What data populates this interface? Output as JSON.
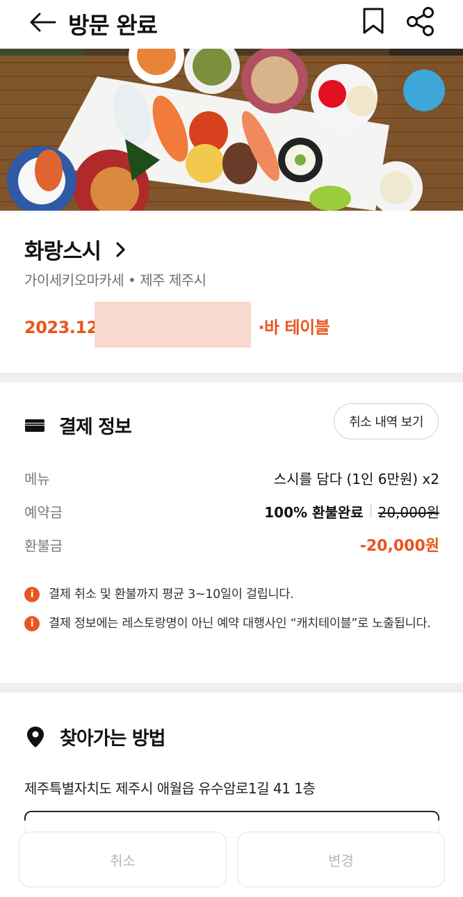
{
  "header": {
    "title": "방문 완료",
    "back_icon": "arrow-left-icon",
    "bookmark_icon": "bookmark-icon",
    "share_icon": "share-icon"
  },
  "hero": {
    "image": "sushi-platter-photo"
  },
  "restaurant": {
    "name": "화랑스시",
    "category_location": "가이세키오마카세 • 제주 제주시",
    "booking_prefix": "2023.12.",
    "booking_suffix": "·바 테이블"
  },
  "payment": {
    "title": "결제 정보",
    "cancel_history_button": "취소 내역 보기",
    "menu_label": "메뉴",
    "menu_value": "스시를 담다 (1인 6만원) x2",
    "deposit_label": "예약금",
    "deposit_status": "100% 환불완료",
    "deposit_amount": "20,000원",
    "refund_label": "환불금",
    "refund_amount": "-20,000원",
    "notices": [
      "결제 취소 및 환불까지 평균 3~10일이 걸립니다.",
      "결제 정보에는 레스토랑명이 아닌 예약 대행사인 “캐치테이블”로 노출됩니다."
    ]
  },
  "directions": {
    "title": "찾아가는 방법",
    "address": "제주특별자치도 제주시 애월읍 유수암로1길 41 1층"
  },
  "bottom": {
    "cancel_button": "취소",
    "change_button": "변경"
  },
  "colors": {
    "accent": "#e9541d",
    "divider": "#efefef",
    "redaction": "#f9d8cd"
  }
}
